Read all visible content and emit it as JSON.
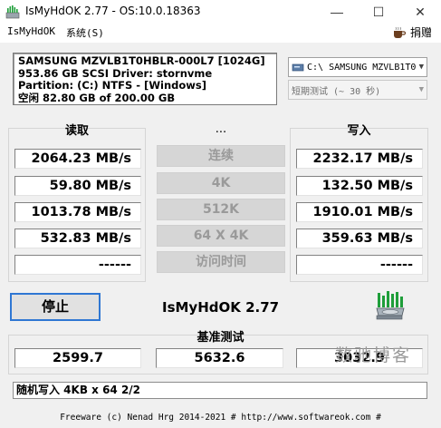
{
  "window": {
    "title": "IsMyHdOK 2.77 - OS:10.0.18363",
    "minimize_glyph": "—",
    "maximize_glyph": "☐",
    "close_glyph": "✕"
  },
  "menu": {
    "items": [
      "IsMyHdOK",
      "系统(S)"
    ],
    "donate_label": "捐赠",
    "donate_icon": "coffee-cup-icon"
  },
  "drive_info": {
    "line1": "SAMSUNG MZVLB1T0HBLR-000L7 [1024G]",
    "line2": "953.86 GB  SCSI Driver: stornvme",
    "line3": "Partition: (C:) NTFS - [Windows]",
    "line4": "空闲 82.80 GB of 200.00 GB"
  },
  "drive_select": {
    "value": "C:\\ SAMSUNG MZVLB1T0"
  },
  "mode_select": {
    "value": "短期测试 (~ 30 秒)"
  },
  "columns": {
    "read": "读取",
    "middle": "...",
    "write": "写入"
  },
  "tests": [
    {
      "label": "连续",
      "read": "2064.23 MB/s",
      "write": "2232.17 MB/s"
    },
    {
      "label": "4K",
      "read": "59.80 MB/s",
      "write": "132.50 MB/s"
    },
    {
      "label": "512K",
      "read": "1013.78 MB/s",
      "write": "1910.01 MB/s"
    },
    {
      "label": "64 X 4K",
      "read": "532.83 MB/s",
      "write": "359.63 MB/s"
    },
    {
      "label": "访问时间",
      "read": "------",
      "write": "------"
    }
  ],
  "controls": {
    "stop_label": "停止",
    "app_name": "IsMyHdOK 2.77"
  },
  "benchmark": {
    "title": "基准测试",
    "read_score": "2599.7",
    "total_score": "5632.6",
    "write_score": "3032.9"
  },
  "status": {
    "text": "随机写入 4KB x 64 2/2"
  },
  "footer": {
    "text": "Freeware (c) Nenad Hrg 2014-2021 # http://www.softwareok.com   #"
  },
  "watermark": {
    "text": "数驰博客"
  },
  "colors": {
    "focus_border": "#2f77d3",
    "disabled_button": "#d6d6d6",
    "hdd_icon_green": "#1f9e3a"
  }
}
